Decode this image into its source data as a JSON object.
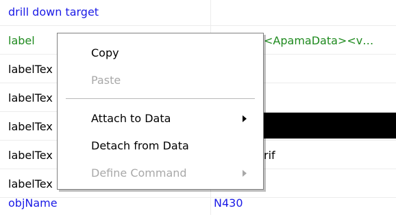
{
  "grid": {
    "rows": [
      {
        "name": "drill down target",
        "value": "",
        "name_color": "#1a1ae6"
      },
      {
        "name": "label",
        "value": "<ApamaData><v…",
        "name_color": "#1e8a1e",
        "value_color": "#1e8a1e"
      },
      {
        "name": "labelTex",
        "value": ""
      },
      {
        "name": "labelTex",
        "value": ""
      },
      {
        "name": "labelTex",
        "value": ""
      },
      {
        "name": "labelTex",
        "value": "rif"
      },
      {
        "name": "labelTex",
        "value": ""
      },
      {
        "name": "objName",
        "value": "N430",
        "name_color": "#1a1ae6",
        "value_color": "#1a1ae6"
      }
    ]
  },
  "context_menu": {
    "items": [
      {
        "label": "Copy",
        "enabled": true,
        "submenu": false
      },
      {
        "label": "Paste",
        "enabled": false,
        "submenu": false
      },
      {
        "label": "Attach to Data",
        "enabled": true,
        "submenu": true
      },
      {
        "label": "Detach from Data",
        "enabled": true,
        "submenu": false
      },
      {
        "label": "Define Command",
        "enabled": false,
        "submenu": true
      }
    ]
  },
  "colors": {
    "blue_text": "#1a1ae6",
    "green_text": "#1e8a1e",
    "disabled_text": "#a8a8a8",
    "selection_bar": "#000000"
  }
}
